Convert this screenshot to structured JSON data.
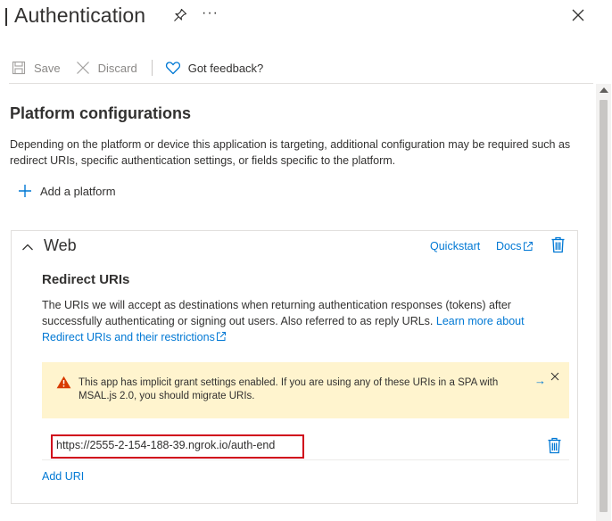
{
  "header": {
    "title": "Authentication",
    "more_label": "···"
  },
  "toolbar": {
    "save_label": "Save",
    "discard_label": "Discard",
    "feedback_label": "Got feedback?"
  },
  "platform": {
    "title": "Platform configurations",
    "description": "Depending on the platform or device this application is targeting, additional configuration may be required such as redirect URIs, specific authentication settings, or fields specific to the platform.",
    "add_label": "Add a platform"
  },
  "web_card": {
    "title": "Web",
    "quickstart_label": "Quickstart",
    "docs_label": "Docs",
    "redirect_title": "Redirect URIs",
    "redirect_desc": "The URIs we will accept as destinations when returning authentication responses (tokens) after successfully authenticating or signing out users. Also referred to as reply URLs.",
    "learn_more_label": "Learn more about Redirect URIs and their restrictions",
    "warning_text": "This app has implicit grant settings enabled. If you are using any of these URIs in a SPA with MSAL.js 2.0, you should migrate URIs.",
    "warning_arrow": "→",
    "uri_value": "https://2555-2-154-188-39.ngrok.io/auth-end",
    "add_uri_label": "Add URI"
  },
  "colors": {
    "accent": "#0078d4",
    "warning_bg": "#fff4ce",
    "warning_icon": "#d83b01",
    "highlight_border": "#d0021b"
  },
  "icons": {
    "pin": "pin-icon",
    "more": "more-icon",
    "close": "close-icon",
    "save": "save-icon",
    "discard": "discard-icon",
    "feedback": "heart-icon",
    "add": "plus-icon",
    "collapse": "chevron-up-icon",
    "external": "external-link-icon",
    "delete": "trash-icon",
    "warning": "warning-icon"
  }
}
